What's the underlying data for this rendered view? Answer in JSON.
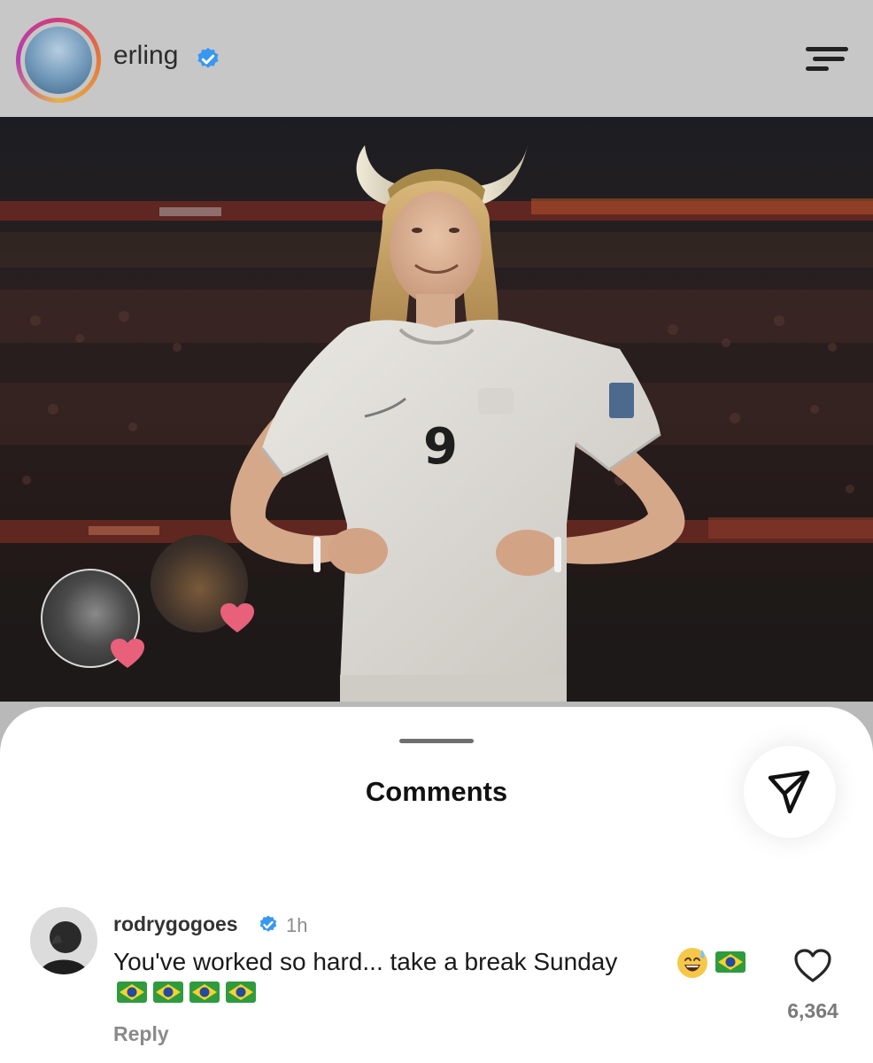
{
  "header": {
    "username": "erling",
    "verified": true,
    "avatar_icon": "profile-avatar-with-story-ring",
    "menu_icon": "menu-icon",
    "story_ring_colors": [
      "#d23b7d",
      "#e4783a",
      "#e7b04a",
      "#b43fb0"
    ]
  },
  "post": {
    "image_icon": "photo",
    "jersey_number": "9",
    "reactions": [
      {
        "icon": "heart-icon",
        "color": "#e8607a"
      },
      {
        "icon": "heart-icon",
        "color": "#e8607a"
      }
    ]
  },
  "comments_sheet": {
    "title": "Comments",
    "share_icon": "send-icon",
    "comments": [
      {
        "username": "rodrygogoes",
        "verified": true,
        "time": "1h",
        "text": "You've worked so hard... take a break Sunday",
        "emojis": [
          "sweat-smile-emoji",
          "brazil-flag-emoji",
          "brazil-flag-emoji",
          "brazil-flag-emoji",
          "brazil-flag-emoji",
          "brazil-flag-emoji"
        ],
        "reply_label": "Reply",
        "like_count": "6,364"
      }
    ]
  },
  "colors": {
    "verified_blue": "#3897f0",
    "heart_pink": "#e8607a"
  }
}
